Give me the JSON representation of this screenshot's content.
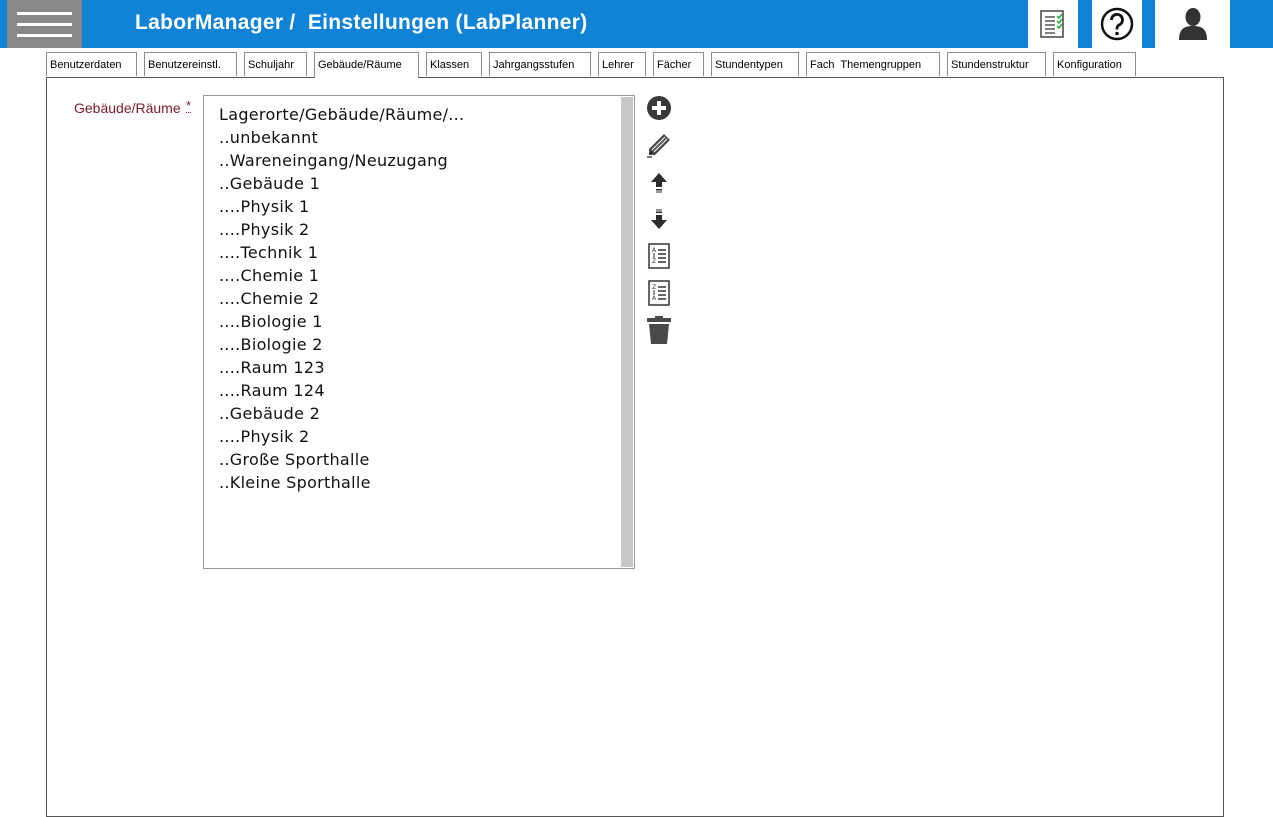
{
  "header": {
    "title": "LaborManager /  Einstellungen (LabPlanner)",
    "icons": {
      "menu": "hamburger-menu-icon",
      "tasks": "checklist-icon",
      "help": "help-icon",
      "user": "user-icon"
    }
  },
  "tabs": [
    {
      "label": "Benutzerdaten",
      "active": false
    },
    {
      "label": "Benutzereinstl.",
      "active": false
    },
    {
      "label": "Schuljahr",
      "active": false
    },
    {
      "label": "Gebäude/Räume",
      "active": true
    },
    {
      "label": "Klassen",
      "active": false
    },
    {
      "label": "Jahrgangsstufen",
      "active": false
    },
    {
      "label": "Lehrer",
      "active": false
    },
    {
      "label": "Fächer",
      "active": false
    },
    {
      "label": "Stundentypen",
      "active": false
    },
    {
      "label": "Fach  Themengruppen",
      "active": false
    },
    {
      "label": "Stundenstruktur",
      "active": false
    },
    {
      "label": "Konfiguration",
      "active": false
    }
  ],
  "form": {
    "label": "Gebäude/Räume",
    "required_marker": "*",
    "items": [
      "Lagerorte/Gebäude/Räume/...",
      "..unbekannt",
      "..Wareneingang/Neuzugang",
      "..Gebäude 1",
      "....Physik 1",
      "....Physik 2",
      "....Technik 1",
      "....Chemie 1",
      "....Chemie 2",
      "....Biologie 1",
      "....Biologie 2",
      "....Raum 123",
      "....Raum 124",
      "..Gebäude 2",
      "....Physik 2",
      "..Große Sporthalle",
      "..Kleine Sporthalle"
    ]
  },
  "toolbar": [
    "add-icon",
    "edit-icon",
    "move-up-icon",
    "move-down-icon",
    "sort-ascending-icon",
    "sort-descending-icon",
    "delete-icon"
  ],
  "colors": {
    "header_bg": "#1183d6",
    "menu_bg": "#888888",
    "label": "#7d1a26",
    "scrollbar": "#c8c8c8"
  }
}
